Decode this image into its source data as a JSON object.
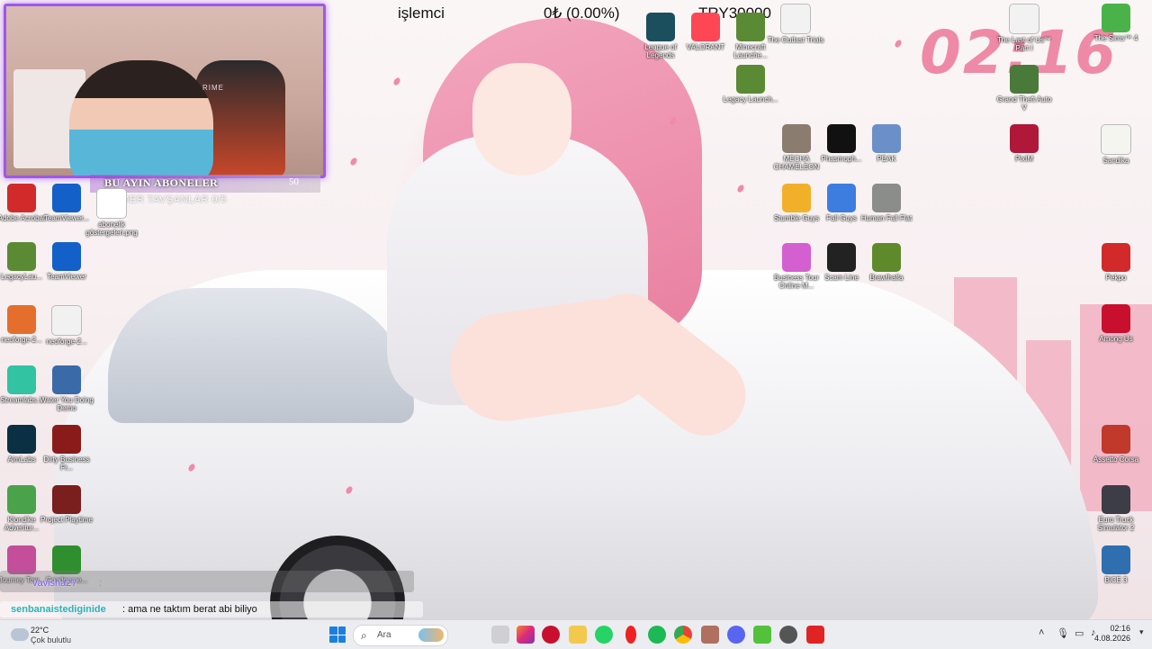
{
  "overlay": {
    "cpu_label": "işlemci",
    "balance": "0₺ (0.00%)",
    "goal": "TRY30000",
    "clock": "02:16",
    "subs_title": "BU AYIN ABONELER",
    "subs_count": "50",
    "subs_ticker": "ELEMER TAVŞANLAR 0/5"
  },
  "webcam": {
    "brand_text": "RIME"
  },
  "chat": {
    "prev_user": "vavisha27",
    "prev_sep": ":",
    "user": "senbanaistedigini de",
    "user_display": "senbanaistediginide",
    "message": ": ama ne taktım berat abi biliyo"
  },
  "icons_left": [
    {
      "label": "Adobe Acrobat",
      "icon": "pdf-icon",
      "color": "#d22a2a"
    },
    {
      "label": "TeamViewer...",
      "icon": "teamviewer-icon",
      "color": "#1360c8"
    },
    {
      "label": "abonelik göstergeleri.png",
      "icon": "file-icon",
      "color": "#ffffff"
    },
    {
      "label": "LegacyLau...",
      "icon": "minecraft-icon",
      "color": "#5b8a34"
    },
    {
      "label": "TeamViewer",
      "icon": "teamviewer-icon",
      "color": "#1360c8"
    },
    {
      "label": "neoforge-2...",
      "icon": "java-icon",
      "color": "#e46f2c"
    },
    {
      "label": "neoforge-2...",
      "icon": "file-icon",
      "color": "#f1f1f1"
    },
    {
      "label": "Streamlabs...",
      "icon": "streamlabs-icon",
      "color": "#31c3a2"
    },
    {
      "label": "Water You Doing Demo",
      "icon": "question-icon",
      "color": "#3a6aa8"
    },
    {
      "label": "AimLabs",
      "icon": "aimlabs-icon",
      "color": "#0b2f43"
    },
    {
      "label": "Dirty Business Fr...",
      "icon": "game-icon",
      "color": "#8a1b1b"
    },
    {
      "label": "Klondike Adventur...",
      "icon": "game-icon",
      "color": "#4aa34a"
    },
    {
      "label": "Project Playtime",
      "icon": "game-icon",
      "color": "#7a1e1e"
    },
    {
      "label": "Journey Tow...",
      "icon": "game-icon",
      "color": "#c44e9a"
    },
    {
      "label": "Goodgame...",
      "icon": "game-icon",
      "color": "#2f8f2f"
    }
  ],
  "icons_top": [
    {
      "label": "League of Legends",
      "icon": "game-icon",
      "color": "#1c4f5e"
    },
    {
      "label": "VALORANT",
      "icon": "valorant-icon",
      "color": "#ff4655"
    },
    {
      "label": "Minecraft Launche...",
      "icon": "minecraft-icon",
      "color": "#5b8a34"
    },
    {
      "label": "The Outlast Trials",
      "icon": "file-icon",
      "color": "#f2f2f2"
    },
    {
      "label": "Legacy Launch...",
      "icon": "minecraft-icon",
      "color": "#5b8a34"
    },
    {
      "label": "MECHA CHAMELEON",
      "icon": "game-icon",
      "color": "#8a7d70"
    },
    {
      "label": "Phasmoph...",
      "icon": "phasmophobia-icon",
      "color": "#111111"
    },
    {
      "label": "PEAK",
      "icon": "peak-icon",
      "color": "#6b8fc8"
    },
    {
      "label": "Stumble Guys",
      "icon": "game-icon",
      "color": "#f2b02a"
    },
    {
      "label": "Fall Guys",
      "icon": "game-icon",
      "color": "#3e7de0"
    },
    {
      "label": "Human Fall Flat",
      "icon": "game-icon",
      "color": "#8a8d8a"
    },
    {
      "label": "Business Tour Online M...",
      "icon": "game-icon",
      "color": "#d45fd1"
    },
    {
      "label": "Scam Line",
      "icon": "game-icon",
      "color": "#222222"
    },
    {
      "label": "Brawlhalla",
      "icon": "game-icon",
      "color": "#5e8a2c"
    }
  ],
  "icons_right": [
    {
      "label": "The Last of Us™ Part I",
      "icon": "file-icon",
      "color": "#f2f2f2"
    },
    {
      "label": "The Sims™ 4",
      "icon": "sims-icon",
      "color": "#49b34a"
    },
    {
      "label": "Grand Theft Auto V",
      "icon": "gta-icon",
      "color": "#4a7a3a"
    },
    {
      "label": "PixIM",
      "icon": "pixim-icon",
      "color": "#b0183a"
    },
    {
      "label": "Sandika",
      "icon": "sandika-icon",
      "color": "#f5f5f0"
    },
    {
      "label": "Pekpo",
      "icon": "game-icon",
      "color": "#d22a2a"
    },
    {
      "label": "Among Us",
      "icon": "amongus-icon",
      "color": "#c8102e"
    },
    {
      "label": "Assetto Corsa",
      "icon": "game-icon",
      "color": "#c0392b"
    },
    {
      "label": "Euro Truck Simulator 2",
      "icon": "game-icon",
      "color": "#3d3d48"
    },
    {
      "label": "BiCE 3",
      "icon": "game-icon",
      "color": "#2f6fb0"
    }
  ],
  "taskbar": {
    "temperature": "22°C",
    "weather": "Çok bulutlu",
    "search_placeholder": "Ara",
    "time": "02:16",
    "date": "4.08.2026"
  }
}
